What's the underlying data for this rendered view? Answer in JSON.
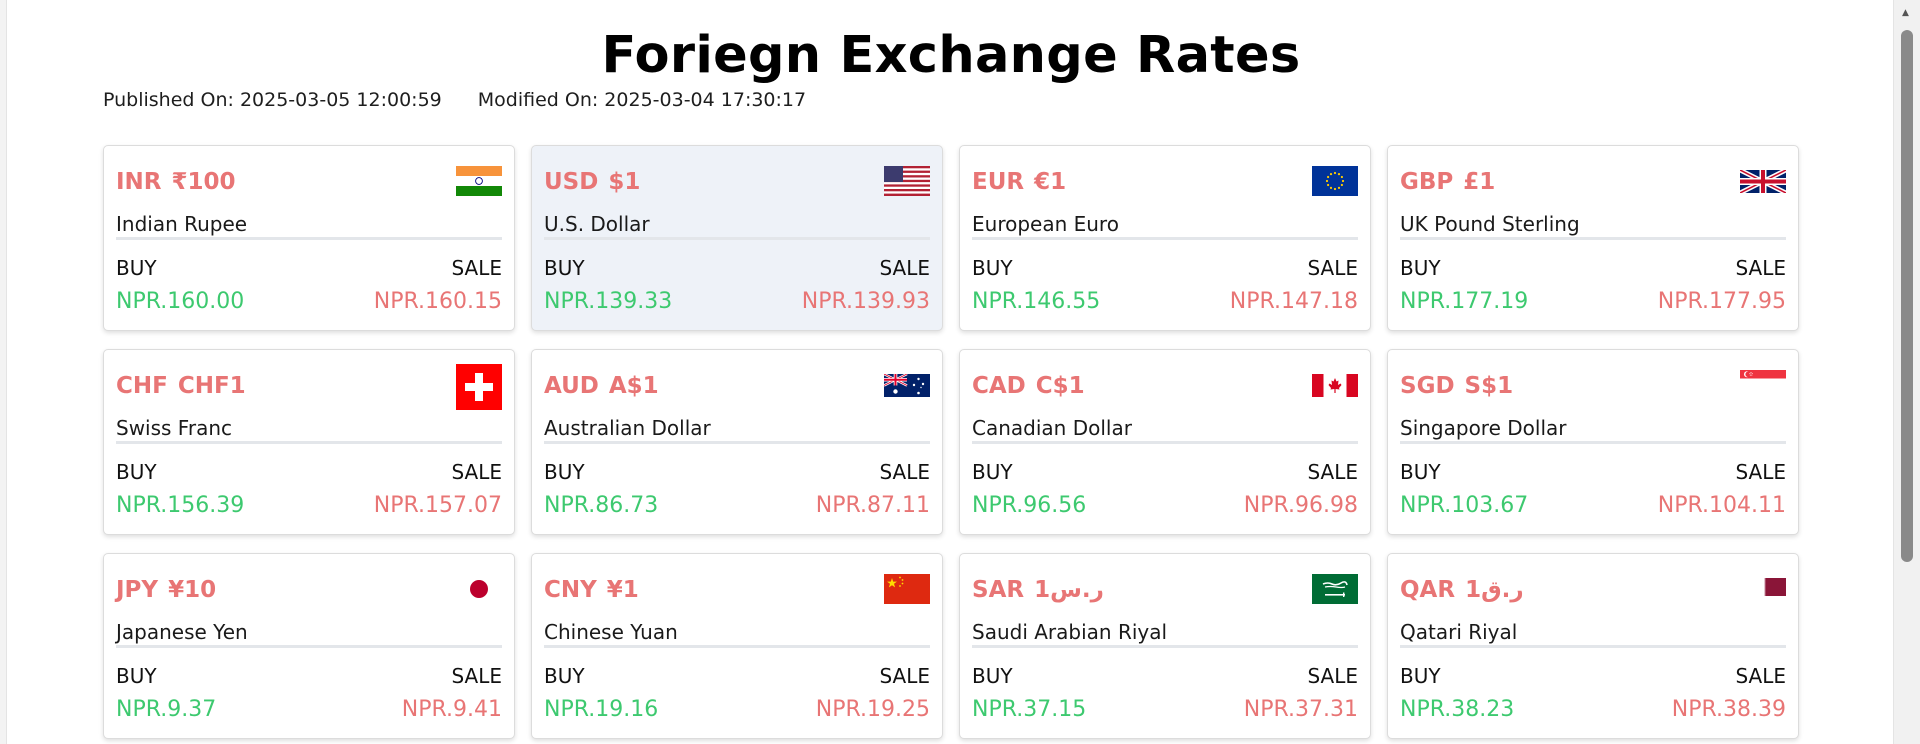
{
  "page": {
    "title": "Foriegn Exchange Rates",
    "published": "Published On: 2025-03-05 12:00:59",
    "modified": "Modified On: 2025-03-04 17:30:17"
  },
  "labels": {
    "buy": "BUY",
    "sale": "SALE"
  },
  "colors": {
    "code": "#e87575",
    "buy": "#3dc96f",
    "sale": "#e87575",
    "active_card": "#eef2f8"
  },
  "cards": [
    {
      "code": "INR",
      "symbol": "₹100",
      "name": "Indian Rupee",
      "buy": "NPR.160.00",
      "sale": "NPR.160.15",
      "flag": "india-flag-icon"
    },
    {
      "code": "USD",
      "symbol": "$1",
      "name": "U.S. Dollar",
      "buy": "NPR.139.33",
      "sale": "NPR.139.93",
      "flag": "usa-flag-icon",
      "active": true
    },
    {
      "code": "EUR",
      "symbol": "€1",
      "name": "European Euro",
      "buy": "NPR.146.55",
      "sale": "NPR.147.18",
      "flag": "eu-flag-icon"
    },
    {
      "code": "GBP",
      "symbol": "£1",
      "name": "UK Pound Sterling",
      "buy": "NPR.177.19",
      "sale": "NPR.177.95",
      "flag": "uk-flag-icon"
    },
    {
      "code": "CHF",
      "symbol": "CHF1",
      "name": "Swiss Franc",
      "buy": "NPR.156.39",
      "sale": "NPR.157.07",
      "flag": "switzerland-flag-icon"
    },
    {
      "code": "AUD",
      "symbol": "A$1",
      "name": "Australian Dollar",
      "buy": "NPR.86.73",
      "sale": "NPR.87.11",
      "flag": "australia-flag-icon"
    },
    {
      "code": "CAD",
      "symbol": "C$1",
      "name": "Canadian Dollar",
      "buy": "NPR.96.56",
      "sale": "NPR.96.98",
      "flag": "canada-flag-icon"
    },
    {
      "code": "SGD",
      "symbol": "S$1",
      "name": "Singapore Dollar",
      "buy": "NPR.103.67",
      "sale": "NPR.104.11",
      "flag": "singapore-flag-icon"
    },
    {
      "code": "JPY",
      "symbol": "¥10",
      "name": "Japanese Yen",
      "buy": "NPR.9.37",
      "sale": "NPR.9.41",
      "flag": "japan-flag-icon"
    },
    {
      "code": "CNY",
      "symbol": "¥1",
      "name": "Chinese Yuan",
      "buy": "NPR.19.16",
      "sale": "NPR.19.25",
      "flag": "china-flag-icon"
    },
    {
      "code": "SAR",
      "symbol": "ر.س1",
      "name": "Saudi Arabian Riyal",
      "buy": "NPR.37.15",
      "sale": "NPR.37.31",
      "flag": "saudi-arabia-flag-icon"
    },
    {
      "code": "QAR",
      "symbol": "ر.ق1",
      "name": "Qatari Riyal",
      "buy": "NPR.38.23",
      "sale": "NPR.38.39",
      "flag": "qatar-flag-icon"
    }
  ]
}
